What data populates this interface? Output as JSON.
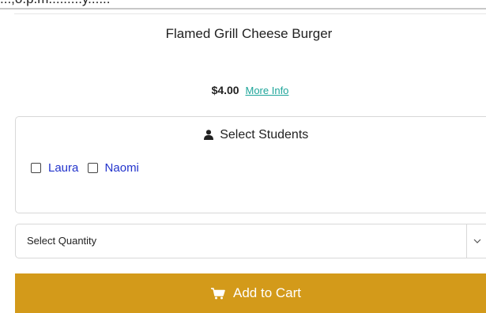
{
  "item": {
    "partial_heading": "...,o.p.m.........y......",
    "name": "Flamed Grill Cheese Burger",
    "price": "$4.00",
    "more_info_label": "More Info"
  },
  "students_panel": {
    "title": "Select Students",
    "students": [
      {
        "name": "Laura",
        "checked": false
      },
      {
        "name": "Naomi",
        "checked": false
      }
    ]
  },
  "quantity": {
    "placeholder": "Select Quantity"
  },
  "cart": {
    "button_label": "Add to Cart"
  },
  "colors": {
    "accent": "#d39a1a",
    "link": "#1ea59a",
    "student_name": "#2233cc"
  },
  "icons": {
    "user": "user-icon",
    "cart": "shopping-cart-icon",
    "chevron": "chevron-down-icon"
  }
}
